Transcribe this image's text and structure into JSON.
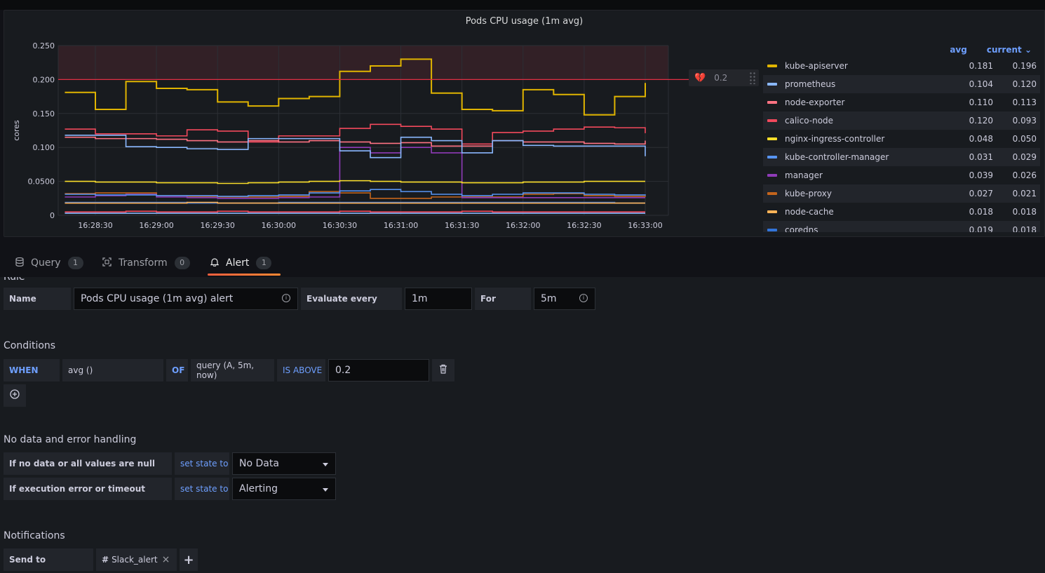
{
  "panel": {
    "title": "Pods CPU usage (1m avg)",
    "threshold_label": "0.2"
  },
  "chart_data": {
    "type": "line",
    "title": "Pods CPU usage (1m avg)",
    "ylabel": "cores",
    "xlabel": "",
    "ylim": [
      0,
      0.25
    ],
    "y_ticks": [
      "0",
      "0.0500",
      "0.100",
      "0.150",
      "0.200",
      "0.250"
    ],
    "x": [
      "16:28:30",
      "16:29:00",
      "16:29:30",
      "16:30:00",
      "16:30:30",
      "16:31:00",
      "16:31:30",
      "16:32:00",
      "16:32:30",
      "16:33:00"
    ],
    "threshold": 0.2,
    "step_starts": [
      "16:28:15",
      "16:28:30",
      "16:28:45",
      "16:29:00",
      "16:29:15",
      "16:29:30",
      "16:29:45",
      "16:30:00",
      "16:30:15",
      "16:30:30",
      "16:30:45",
      "16:31:00",
      "16:31:15",
      "16:31:30",
      "16:31:45",
      "16:32:00",
      "16:32:15",
      "16:32:30",
      "16:32:45",
      "16:33:00"
    ],
    "series": [
      {
        "name": "kube-apiserver",
        "color": "#e0b400",
        "values": [
          0.181,
          0.156,
          0.197,
          0.187,
          0.185,
          0.167,
          0.161,
          0.172,
          0.175,
          0.212,
          0.22,
          0.23,
          0.18,
          0.156,
          0.154,
          0.185,
          0.178,
          0.148,
          0.175,
          0.195
        ]
      },
      {
        "name": "prometheus",
        "color": "#8ab8ff",
        "values": [
          0.118,
          0.118,
          0.101,
          0.1,
          0.098,
          0.097,
          0.113,
          0.113,
          0.113,
          0.095,
          0.085,
          0.115,
          0.11,
          0.092,
          0.11,
          0.103,
          0.102,
          0.102,
          0.102,
          0.087
        ]
      },
      {
        "name": "node-exporter",
        "color": "#ff7383",
        "values": [
          0.115,
          0.113,
          0.113,
          0.112,
          0.11,
          0.108,
          0.11,
          0.108,
          0.11,
          0.108,
          0.106,
          0.107,
          0.102,
          0.102,
          0.11,
          0.108,
          0.108,
          0.106,
          0.105,
          0.11
        ]
      },
      {
        "name": "calico-node",
        "color": "#f2495c",
        "values": [
          0.127,
          0.12,
          0.12,
          0.117,
          0.126,
          0.124,
          0.108,
          0.117,
          0.117,
          0.128,
          0.134,
          0.131,
          0.127,
          0.105,
          0.122,
          0.124,
          0.127,
          0.13,
          0.129,
          0.121
        ]
      },
      {
        "name": "nginx-ingress-controller",
        "color": "#fade2a",
        "values": [
          0.05,
          0.049,
          0.049,
          0.048,
          0.048,
          0.047,
          0.048,
          0.049,
          0.05,
          0.051,
          0.05,
          0.049,
          0.049,
          0.048,
          0.048,
          0.049,
          0.049,
          0.05,
          0.05,
          0.05
        ]
      },
      {
        "name": "kube-controller-manager",
        "color": "#5794f2",
        "values": [
          0.031,
          0.03,
          0.03,
          0.029,
          0.029,
          0.028,
          0.029,
          0.03,
          0.033,
          0.036,
          0.038,
          0.035,
          0.031,
          0.029,
          0.031,
          0.033,
          0.033,
          0.031,
          0.03,
          0.029
        ]
      },
      {
        "name": "manager",
        "color": "#8f3bb8",
        "values": [
          0.027,
          0.029,
          0.031,
          0.027,
          0.026,
          0.025,
          0.025,
          0.026,
          0.027,
          0.1,
          0.092,
          0.1,
          0.092,
          0.026,
          0.026,
          0.026,
          0.026,
          0.026,
          0.026,
          0.026
        ]
      },
      {
        "name": "kube-proxy",
        "color": "#c4651c",
        "values": [
          0.032,
          0.033,
          0.033,
          0.029,
          0.028,
          0.027,
          0.027,
          0.028,
          0.035,
          0.033,
          0.025,
          0.025,
          0.027,
          0.027,
          0.027,
          0.031,
          0.032,
          0.029,
          0.028,
          0.027
        ]
      },
      {
        "name": "node-cache",
        "color": "#ffb357",
        "values": [
          0.018,
          0.018,
          0.018,
          0.018,
          0.019,
          0.018,
          0.018,
          0.018,
          0.018,
          0.018,
          0.018,
          0.018,
          0.018,
          0.018,
          0.018,
          0.018,
          0.018,
          0.018,
          0.018,
          0.018
        ]
      },
      {
        "name": "coredns",
        "color": "#3274d9",
        "values": [
          0.019,
          0.019,
          0.019,
          0.019,
          0.018,
          0.018,
          0.018,
          0.019,
          0.019,
          0.019,
          0.019,
          0.019,
          0.019,
          0.019,
          0.019,
          0.019,
          0.019,
          0.019,
          0.018,
          0.018
        ]
      },
      {
        "name": "",
        "color": "#f2495c",
        "values": [
          0.005,
          0.005,
          0.006,
          0.005,
          0.005,
          0.006,
          0.005,
          0.005,
          0.005,
          0.006,
          0.005,
          0.005,
          0.005,
          0.006,
          0.005,
          0.005,
          0.005,
          0.005,
          0.005,
          0.005
        ]
      },
      {
        "name": "",
        "color": "#8ab8ff",
        "values": [
          0.003,
          0.003,
          0.003,
          0.003,
          0.003,
          0.003,
          0.003,
          0.003,
          0.003,
          0.003,
          0.003,
          0.003,
          0.003,
          0.003,
          0.003,
          0.003,
          0.003,
          0.003,
          0.003,
          0.003
        ]
      }
    ]
  },
  "legend": {
    "col_avg": "avg",
    "col_current": "current",
    "items": [
      {
        "name": "kube-apiserver",
        "avg": "0.181",
        "current": "0.196",
        "color": "#e0b400"
      },
      {
        "name": "prometheus",
        "avg": "0.104",
        "current": "0.120",
        "color": "#8ab8ff"
      },
      {
        "name": "node-exporter",
        "avg": "0.110",
        "current": "0.113",
        "color": "#ff7383"
      },
      {
        "name": "calico-node",
        "avg": "0.120",
        "current": "0.093",
        "color": "#f2495c"
      },
      {
        "name": "nginx-ingress-controller",
        "avg": "0.048",
        "current": "0.050",
        "color": "#fade2a"
      },
      {
        "name": "kube-controller-manager",
        "avg": "0.031",
        "current": "0.029",
        "color": "#5794f2"
      },
      {
        "name": "manager",
        "avg": "0.039",
        "current": "0.026",
        "color": "#8f3bb8"
      },
      {
        "name": "kube-proxy",
        "avg": "0.027",
        "current": "0.021",
        "color": "#c4651c"
      },
      {
        "name": "node-cache",
        "avg": "0.018",
        "current": "0.018",
        "color": "#ffb357"
      },
      {
        "name": "coredns",
        "avg": "0.019",
        "current": "0.018",
        "color": "#3274d9"
      }
    ]
  },
  "tabs": [
    {
      "label": "Query",
      "count": "1",
      "icon": "database-icon"
    },
    {
      "label": "Transform",
      "count": "0",
      "icon": "transform-icon"
    },
    {
      "label": "Alert",
      "count": "1",
      "icon": "bell-icon"
    }
  ],
  "rule": {
    "section_label": "Rule",
    "name_label": "Name",
    "name_value": "Pods CPU usage (1m avg) alert",
    "evaluate_label": "Evaluate every",
    "evaluate_value": "1m",
    "for_label": "For",
    "for_value": "5m"
  },
  "conditions": {
    "title": "Conditions",
    "when": "WHEN",
    "reducer": "avg ()",
    "of": "OF",
    "query": "query (A, 5m, now)",
    "evaluator": "IS ABOVE",
    "value": "0.2"
  },
  "nodata": {
    "title": "No data and error handling",
    "row1_label": "If no data or all values are null",
    "row1_action": "set state to",
    "row1_value": "No Data",
    "row2_label": "If execution error or timeout",
    "row2_action": "set state to",
    "row2_value": "Alerting"
  },
  "notifications": {
    "title": "Notifications",
    "send_to_label": "Send to",
    "channel": "Slack_alert"
  }
}
